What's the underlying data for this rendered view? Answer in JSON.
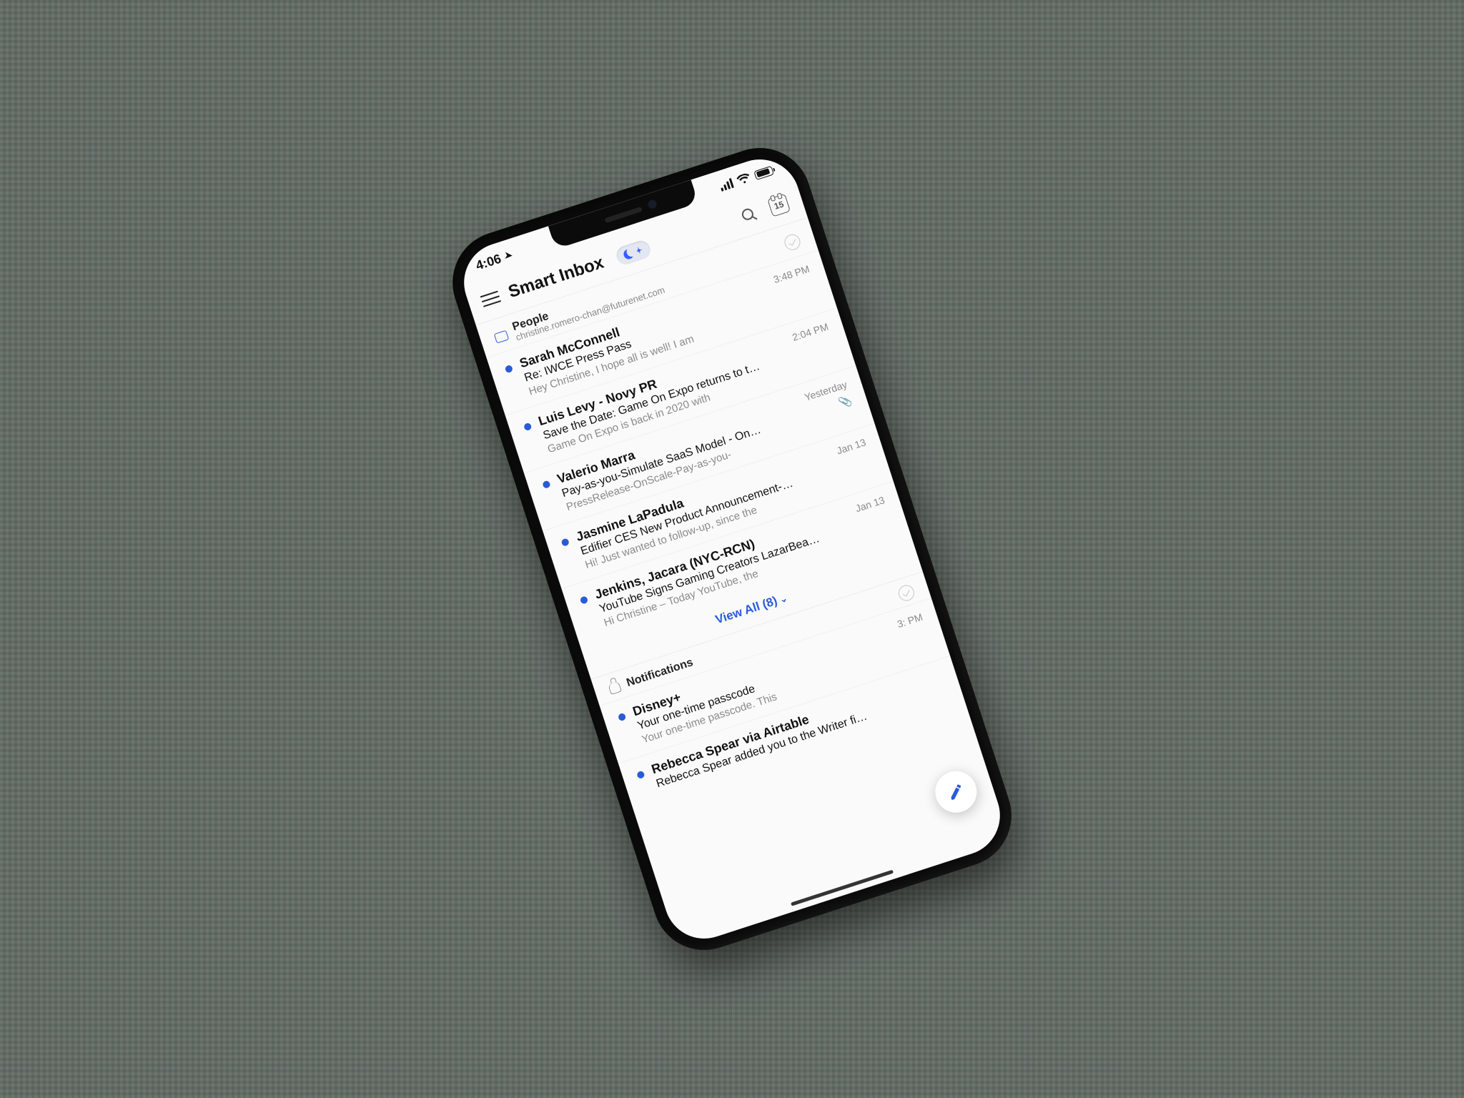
{
  "status": {
    "time": "4:06",
    "location_glyph": "➤",
    "calendar_day": "15"
  },
  "header": {
    "title": "Smart Inbox"
  },
  "sections": {
    "people": {
      "label": "People",
      "account": "christine.romero-chan@futurenet.com",
      "view_all": "View All (8)"
    },
    "notifications": {
      "label": "Notifications"
    }
  },
  "people_emails": [
    {
      "sender": "Sarah McConnell",
      "subject": "Re: IWCE Press Pass",
      "preview": "Hey Christine, I hope all is well! I am",
      "time": "3:48 PM",
      "unread": true,
      "attachment": false
    },
    {
      "sender": "Luis Levy - Novy PR",
      "subject": "Save the Date: Game On Expo returns to t…",
      "preview": "Game On Expo is back in 2020 with",
      "time": "2:04 PM",
      "unread": true,
      "attachment": false
    },
    {
      "sender": "Valerio Marra",
      "subject": "Pay-as-you-Simulate SaaS Model - On…",
      "preview": "PressRelease-OnScale-Pay-as-you-",
      "time": "Yesterday",
      "unread": true,
      "attachment": true
    },
    {
      "sender": "Jasmine LaPadula",
      "subject": "Edifier CES New Product Announcement-…",
      "preview": "Hi! Just wanted to follow-up, since the",
      "time": "Jan 13",
      "unread": true,
      "attachment": false
    },
    {
      "sender": "Jenkins, Jacara (NYC-RCN)",
      "subject": "YouTube Signs Gaming Creators LazarBea…",
      "preview": "Hi Christine – Today YouTube, the",
      "time": "Jan 13",
      "unread": true,
      "attachment": false
    }
  ],
  "notif_emails": [
    {
      "sender": "Disney+",
      "subject": "Your one-time passcode",
      "preview": "Your one-time passcode. This",
      "time": "3:   PM",
      "unread": true
    },
    {
      "sender": "Rebecca Spear via Airtable",
      "subject": "Rebecca Spear added you to the Writer fi…",
      "preview": "",
      "time": "",
      "unread": true
    }
  ]
}
